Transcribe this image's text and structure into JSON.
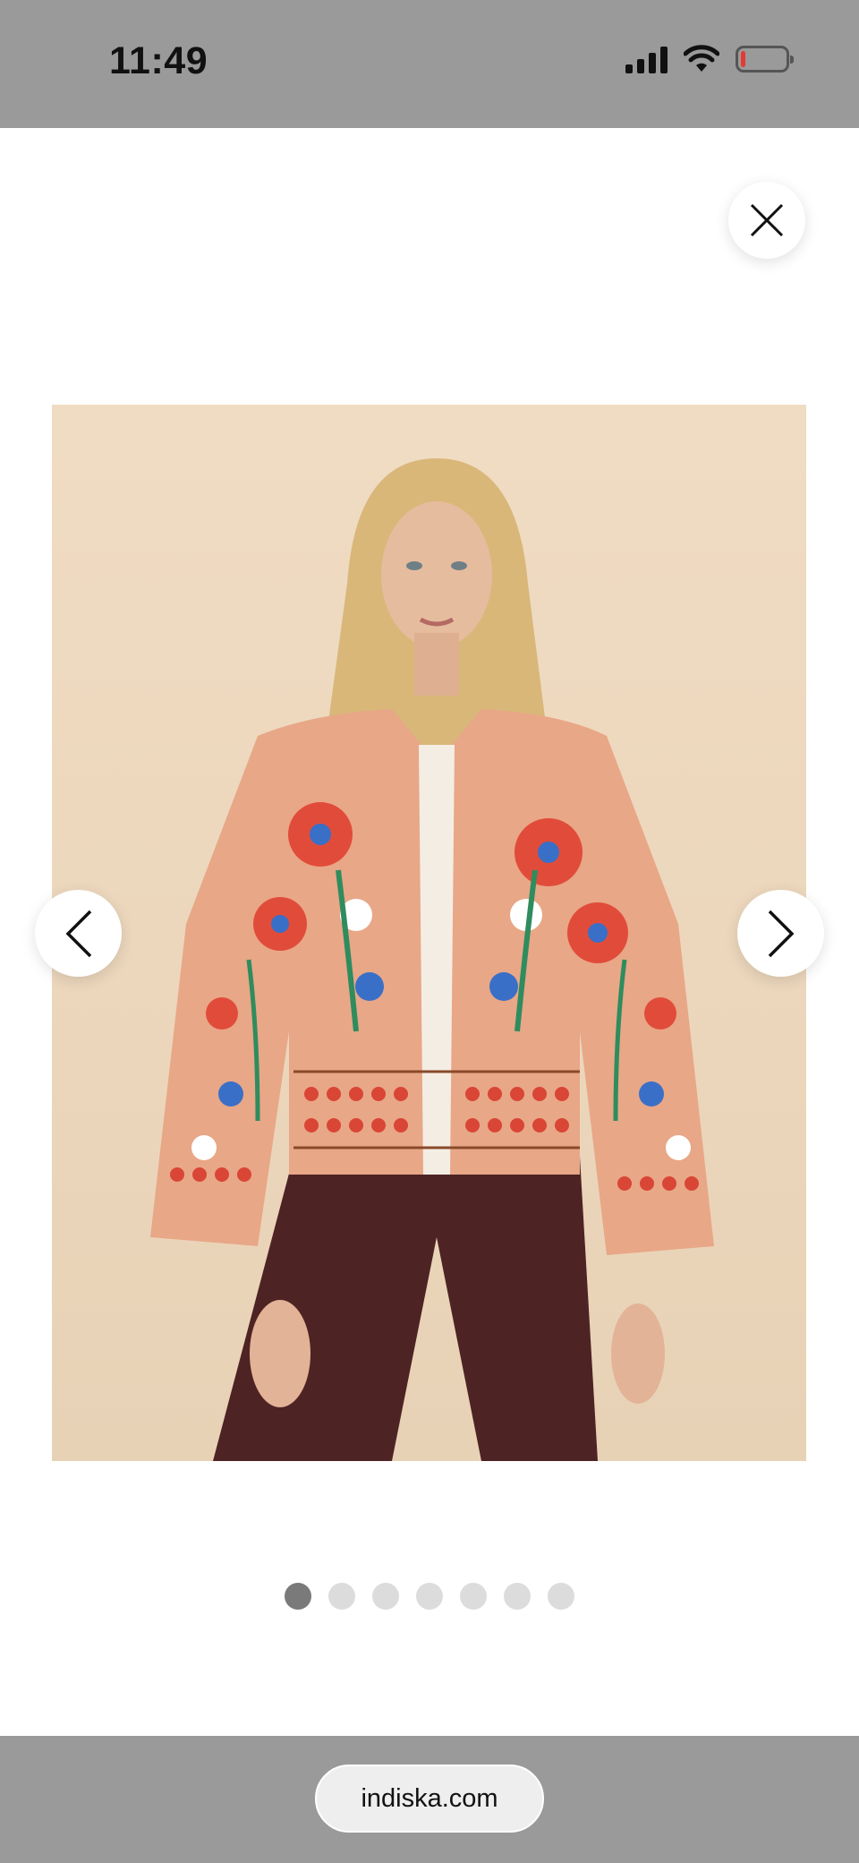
{
  "status_bar": {
    "time": "11:49",
    "battery_level_fraction": 0.1,
    "battery_color": "#e53935"
  },
  "viewer": {
    "close_icon": "close-icon",
    "prev_icon": "chevron-left-icon",
    "next_icon": "chevron-right-icon",
    "image_count": 7,
    "active_index": 0
  },
  "browser": {
    "url": "indiska.com"
  },
  "colors": {
    "chrome_gray": "#9a9a9a",
    "dot_active": "#7a7a7a",
    "dot_inactive": "#dcdcdc",
    "image_background": "#eed9bf"
  }
}
